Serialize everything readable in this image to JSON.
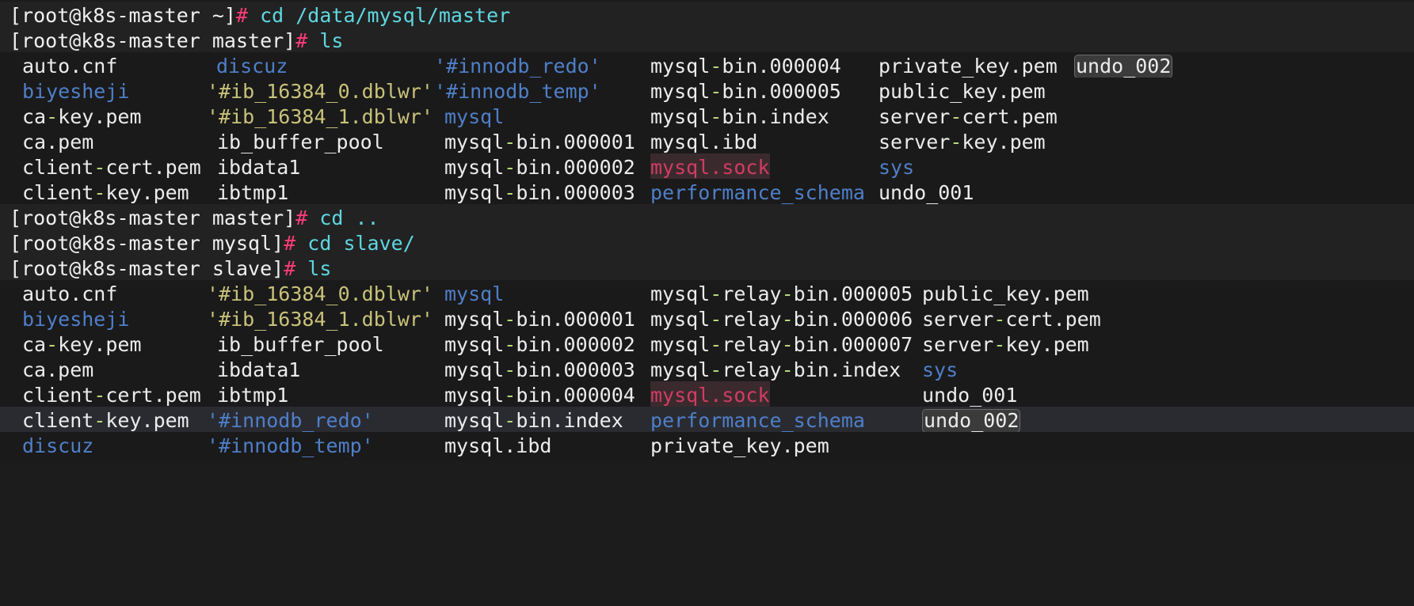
{
  "terminal": {
    "lines": [
      {
        "prompt": "[root@k8s-master ~]",
        "hash": "#",
        "cmd": " cd /data/mysql/master"
      },
      {
        "prompt": "[root@k8s-master master]",
        "hash": "#",
        "cmd": " ls"
      },
      {
        "prompt": "[root@k8s-master master]",
        "hash": "#",
        "cmd": " cd .."
      },
      {
        "prompt": "[root@k8s-master mysql]",
        "hash": "#",
        "cmd": " cd slave/"
      },
      {
        "prompt": "[root@k8s-master slave]",
        "hash": "#",
        "cmd": " ls"
      }
    ],
    "master_listing": {
      "col1": [
        "auto.cnf",
        "biyesheji",
        "ca-key.pem",
        "ca.pem",
        "client-cert.pem",
        "client-key.pem"
      ],
      "col2": [
        "discuz",
        "'#ib_16384_0.dblwr'",
        "'#ib_16384_1.dblwr'",
        "ib_buffer_pool",
        "ibdata1",
        "ibtmp1"
      ],
      "col3": [
        "'#innodb_redo'",
        "'#innodb_temp'",
        "mysql",
        "mysql-bin.000001",
        "mysql-bin.000002",
        "mysql-bin.000003"
      ],
      "col4": [
        "mysql-bin.000004",
        "mysql-bin.000005",
        "mysql-bin.index",
        "mysql.ibd",
        "mysql.sock",
        "performance_schema"
      ],
      "col5": [
        "private_key.pem",
        "public_key.pem",
        "server-cert.pem",
        "server-key.pem",
        "sys",
        "undo_001"
      ],
      "col6": [
        "undo_002"
      ]
    },
    "slave_listing": {
      "col1": [
        "auto.cnf",
        "biyesheji",
        "ca-key.pem",
        "ca.pem",
        "client-cert.pem",
        "client-key.pem",
        "discuz"
      ],
      "col2": [
        "'#ib_16384_0.dblwr'",
        "'#ib_16384_1.dblwr'",
        "ib_buffer_pool",
        "ibdata1",
        "ibtmp1",
        "'#innodb_redo'",
        "'#innodb_temp'"
      ],
      "col3": [
        "mysql",
        "mysql-bin.000001",
        "mysql-bin.000002",
        "mysql-bin.000003",
        "mysql-bin.000004",
        "mysql-bin.index",
        "mysql.ibd"
      ],
      "col4": [
        "mysql-relay-bin.000005",
        "mysql-relay-bin.000006",
        "mysql-relay-bin.000007",
        "mysql-relay-bin.index",
        "mysql.sock",
        "performance_schema",
        "private_key.pem"
      ],
      "col5": [
        "public_key.pem",
        "server-cert.pem",
        "server-key.pem",
        "sys",
        "undo_001",
        "undo_002"
      ]
    },
    "colors": {
      "background": "#1c1c1c",
      "text": "#ececec",
      "prompt_hash": "#ff3c78",
      "command": "#5fd7e0",
      "directory": "#4f7fc9",
      "quoted_file": "#c9c27a",
      "socket": "#d23c63",
      "dash": "#b6d97a"
    }
  }
}
